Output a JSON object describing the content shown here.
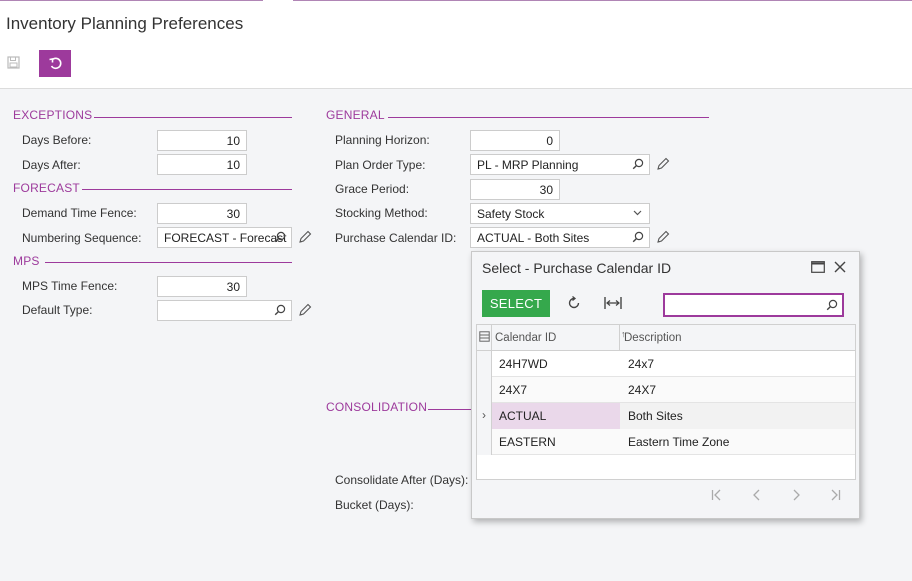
{
  "page": {
    "title": "Inventory Planning Preferences"
  },
  "toolbar": {
    "save_icon": "save-icon",
    "undo_icon": "undo-icon"
  },
  "exceptions": {
    "title": "EXCEPTIONS",
    "days_before": {
      "label": "Days Before:",
      "value": "10"
    },
    "days_after": {
      "label": "Days After:",
      "value": "10"
    }
  },
  "forecast": {
    "title": "FORECAST",
    "demand_time_fence": {
      "label": "Demand Time Fence:",
      "value": "30"
    },
    "numbering_sequence": {
      "label": "Numbering Sequence:",
      "value": "FORECAST - Forecast"
    }
  },
  "mps": {
    "title": "MPS",
    "mps_time_fence": {
      "label": "MPS Time Fence:",
      "value": "30"
    },
    "default_type": {
      "label": "Default Type:",
      "value": ""
    }
  },
  "general": {
    "title": "GENERAL",
    "planning_horizon": {
      "label": "Planning Horizon:",
      "value": "0"
    },
    "plan_order_type": {
      "label": "Plan Order Type:",
      "value": "PL - MRP Planning"
    },
    "grace_period": {
      "label": "Grace Period:",
      "value": "30"
    },
    "stocking_method": {
      "label": "Stocking Method:",
      "value": "Safety Stock"
    },
    "purchase_calendar_id": {
      "label": "Purchase Calendar ID:",
      "value": "ACTUAL - Both Sites"
    }
  },
  "consolidation": {
    "title": "CONSOLIDATION",
    "consolidate_after": {
      "label": "Consolidate After (Days):"
    },
    "bucket": {
      "label": "Bucket (Days):"
    }
  },
  "dialog": {
    "title": "Select - Purchase Calendar ID",
    "select_label": "SELECT",
    "search_value": "",
    "columns": {
      "calendar_id": "Calendar ID",
      "description": "Description"
    },
    "rows": [
      {
        "calendar_id": "24H7WD",
        "description": "24x7"
      },
      {
        "calendar_id": "24X7",
        "description": "24X7"
      },
      {
        "calendar_id": "ACTUAL",
        "description": "Both Sites",
        "active_marker": "›"
      },
      {
        "calendar_id": "EASTERN",
        "description": "Eastern Time Zone"
      }
    ]
  },
  "colors": {
    "accent": "#9d3a9c",
    "select_button": "#35a84c",
    "active_cell": "#ead8ea"
  }
}
